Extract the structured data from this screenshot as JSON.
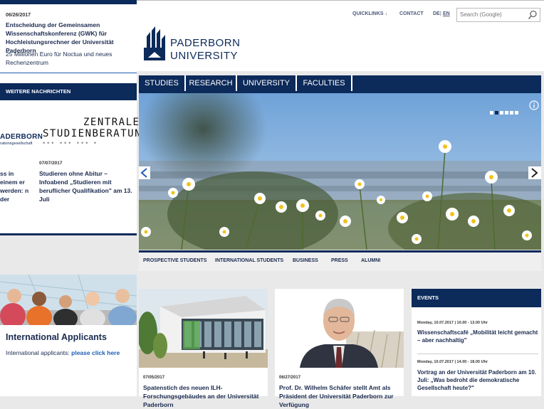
{
  "left_news": {
    "date": "06/26/2017",
    "title": "Entscheidung der Gemeinsamen Wissenschaftskonferenz (GWK) für Hochleistungsrechner der Universität Paderborn",
    "subtitle": "25 Millionen Euro für Noctua und neues Rechenzentrum",
    "more_news_label": "WEITERE NACHRICHTEN",
    "logo_partial": "ADERBORN",
    "logo_partial_sub": "rationsgesellschaft",
    "zsb_line1": "ZENTRALE",
    "zsb_line2": "STUDIENBERATUNG",
    "zsb_dots": "••• ••• ••• •",
    "news2_date": "07/07/2017",
    "news2_title": "Studieren ohne Abitur – Infoabend „Studieren mit beruflicher Qualifikation\" am 13. Juli",
    "news3_fragment": "ss in einem er werden: n der"
  },
  "header": {
    "quicklinks": "QUICKLINKS ↓",
    "contact": "CONTACT",
    "lang_de": "DE",
    "lang_sep": "|",
    "lang_en": "EN",
    "search_placeholder": "Search (Google)",
    "logo_line1": "PADERBORN",
    "logo_line2": "UNIVERSITY"
  },
  "main_nav": [
    "STUDIES",
    "RESEARCH",
    "UNIVERSITY",
    "FACULTIES"
  ],
  "sub_nav": [
    "PROSPECTIVE STUDENTS",
    "INTERNATIONAL STUDENTS",
    "BUSINESS",
    "PRESS",
    "ALUMNI"
  ],
  "hero": {
    "slide_count": 6,
    "active_slide": 2
  },
  "international": {
    "title": "International Applicants",
    "text": "International applicants: ",
    "link": "please click here"
  },
  "news_cards": [
    {
      "date": "07/05/2017",
      "title": "Spatenstich des neuen ILH-Forschungsgebäudes an der Universität Paderborn"
    },
    {
      "date": "06/27/2017",
      "title": "Prof. Dr. Wilhelm Schäfer stellt Amt als Präsident der Universität Paderborn zur Verfügung"
    }
  ],
  "events": {
    "header": "EVENTS",
    "items": [
      {
        "date": "Monday, 10.07.2017 | 10.00 - 13.00 Uhr",
        "title": "Wissenschaftscafé „Mobilität leicht gemacht – aber nachhaltig\""
      },
      {
        "date": "Monday, 10.07.2017 | 14.00 - 18.00 Uhr",
        "title": "Vortrag an der Universität Paderborn am 10. Juli: „Was bedroht die demokratische Gesellschaft heute?\""
      }
    ]
  },
  "colors": {
    "brand_navy": "#0c2a5a",
    "link_blue": "#1d5fb5"
  }
}
